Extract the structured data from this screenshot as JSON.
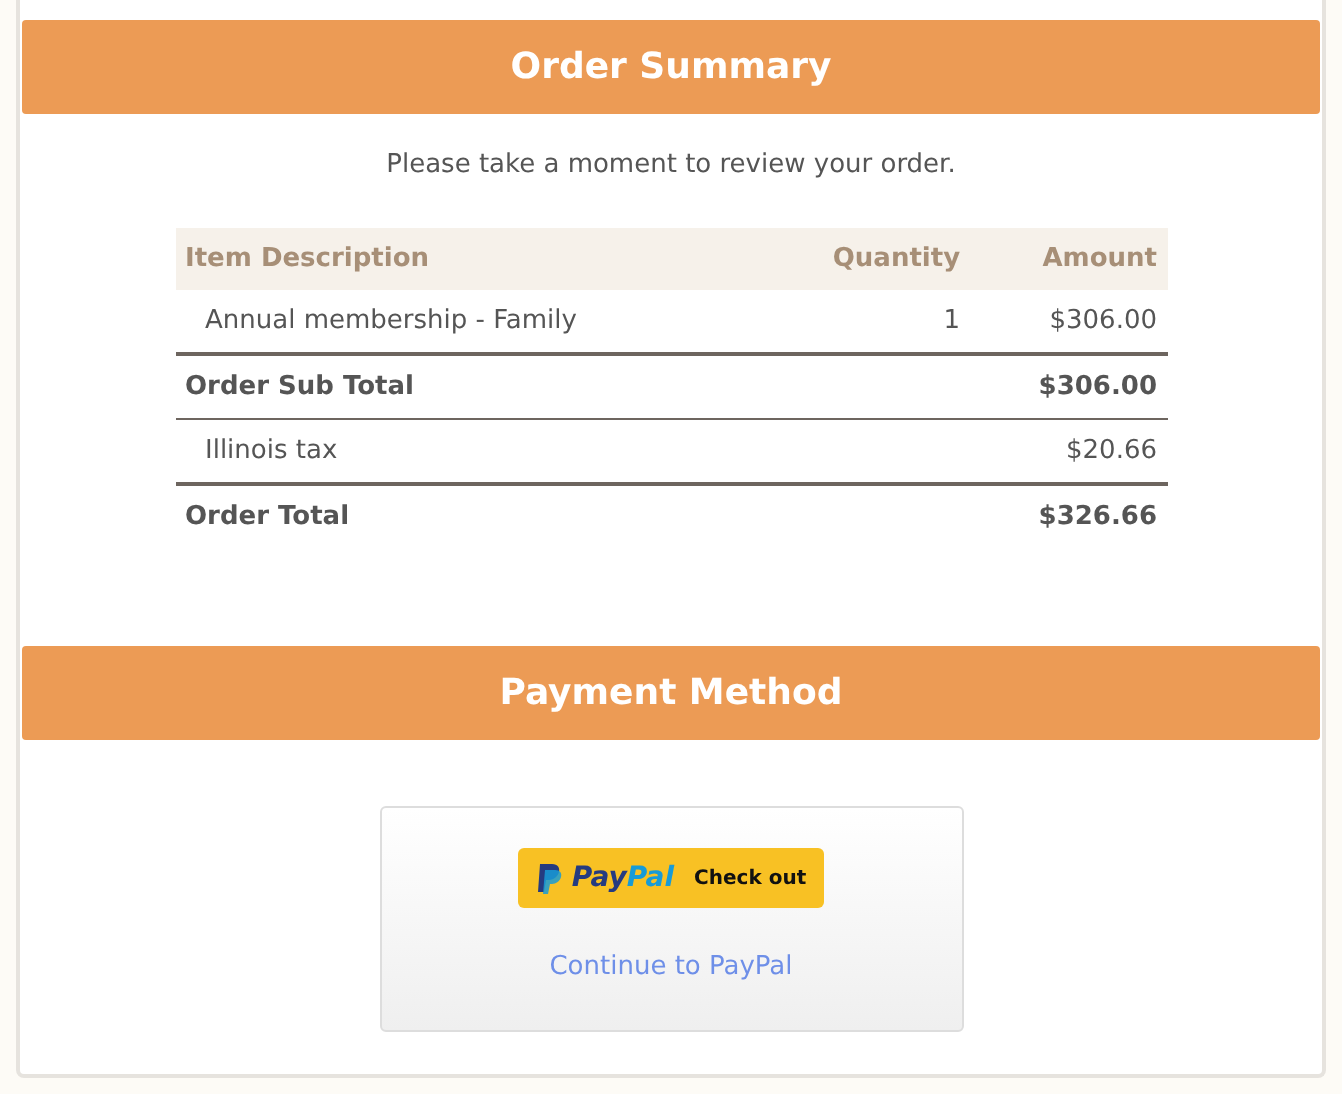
{
  "order_summary": {
    "title": "Order Summary",
    "intro": "Please take a moment to review your order.",
    "table": {
      "columns": [
        "Item Description",
        "Quantity",
        "Amount"
      ],
      "rows": [
        {
          "kind": "item",
          "description": "Annual membership - Family",
          "quantity": "1",
          "amount": "$306.00"
        },
        {
          "kind": "total",
          "description": "Order Sub Total",
          "amount": "$306.00"
        },
        {
          "kind": "item",
          "description": "Illinois tax",
          "amount": "$20.66"
        },
        {
          "kind": "total",
          "description": "Order Total",
          "amount": "$326.66"
        }
      ]
    }
  },
  "payment_method": {
    "title": "Payment Method",
    "paypal_button": {
      "brand_first": "Pay",
      "brand_second": "Pal",
      "label": "Check out"
    },
    "link": "Continue to PayPal"
  }
}
